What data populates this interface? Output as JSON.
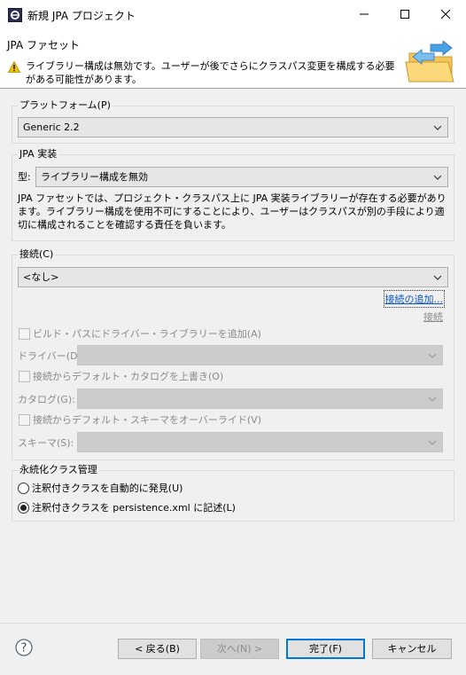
{
  "window": {
    "title": "新規 JPA プロジェクト",
    "icons": {
      "app": "eclipse-icon",
      "minimize": "minimize-icon",
      "maximize": "maximize-icon",
      "close": "close-icon"
    }
  },
  "header": {
    "title": "JPA ファセット",
    "message": "ライブラリー構成は無効です。ユーザーが後でさらにクラスパス変更を構成する必要がある可能性があります。",
    "message_icon": "warning-icon",
    "image_icon": "folder-wizard-icon"
  },
  "platform": {
    "legend": "プラットフォーム(P)",
    "value": "Generic 2.2"
  },
  "jpa_impl": {
    "legend": "JPA 実装",
    "type_label": "型:",
    "type_value": "ライブラリー構成を無効",
    "description": "JPA ファセットでは、プロジェクト・クラスパス上に JPA 実装ライブラリーが存在する必要があります。ライブラリー構成を使用不可にすることにより、ユーザーはクラスパスが別の手段により適切に構成されることを確認する責任を負います。"
  },
  "connection": {
    "legend": "接続(C)",
    "value": "<なし>",
    "add_link": "接続の追加...",
    "connect_link": "接続",
    "add_driver_label": "ビルド・パスにドライバー・ライブラリーを追加(A)",
    "driver_label": "ドライバー(D):",
    "override_catalog_label": "接続からデフォルト・カタログを上書き(O)",
    "catalog_label": "カタログ(G):",
    "override_schema_label": "接続からデフォルト・スキーマをオーバーライド(V)",
    "schema_label": "スキーマ(S):"
  },
  "persistence": {
    "legend": "永続化クラス管理",
    "options": [
      {
        "label": "注釈付きクラスを自動的に発見(U)",
        "selected": false
      },
      {
        "label": "注釈付きクラスを persistence.xml に記述(L)",
        "selected": true
      }
    ]
  },
  "footer": {
    "help_icon": "help-icon",
    "back": "< 戻る(B)",
    "next": "次へ(N) >",
    "finish": "完了(F)",
    "cancel": "キャンセル"
  },
  "colors": {
    "link": "#0a56c8",
    "accent": "#0078d7",
    "warning": "#f2c200"
  }
}
